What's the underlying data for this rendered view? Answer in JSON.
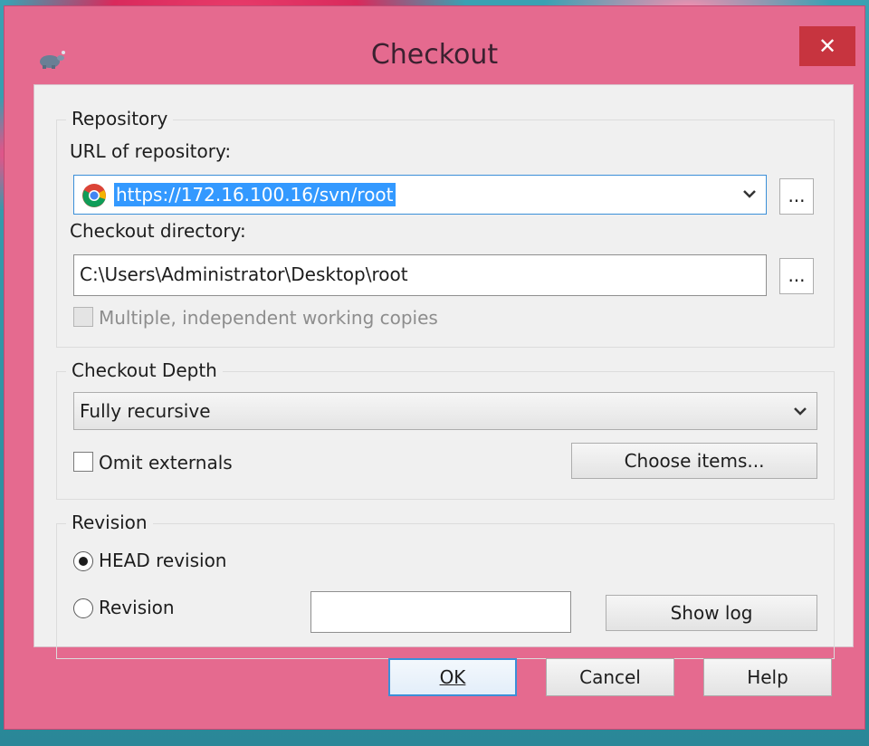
{
  "window": {
    "title": "Checkout",
    "close_label": "✕"
  },
  "repository": {
    "group_title": "Repository",
    "url_label": "URL of repository:",
    "url_value": "https://172.16.100.16/svn/root",
    "browse_label": "...",
    "dir_label": "Checkout directory:",
    "dir_value": "C:\\Users\\Administrator\\Desktop\\root",
    "dir_browse_label": "...",
    "multiple_label": "Multiple, independent working copies"
  },
  "depth": {
    "group_title": "Checkout Depth",
    "selected": "Fully recursive",
    "omit_label": "Omit externals",
    "choose_label": "Choose items..."
  },
  "revision": {
    "group_title": "Revision",
    "head_label": "HEAD revision",
    "revision_label": "Revision",
    "revision_value": "",
    "show_log_label": "Show log"
  },
  "buttons": {
    "ok": "OK",
    "cancel": "Cancel",
    "help": "Help"
  },
  "colors": {
    "window_frame": "#e56a8f",
    "close_button": "#c7343f",
    "selection": "#3399ff"
  }
}
